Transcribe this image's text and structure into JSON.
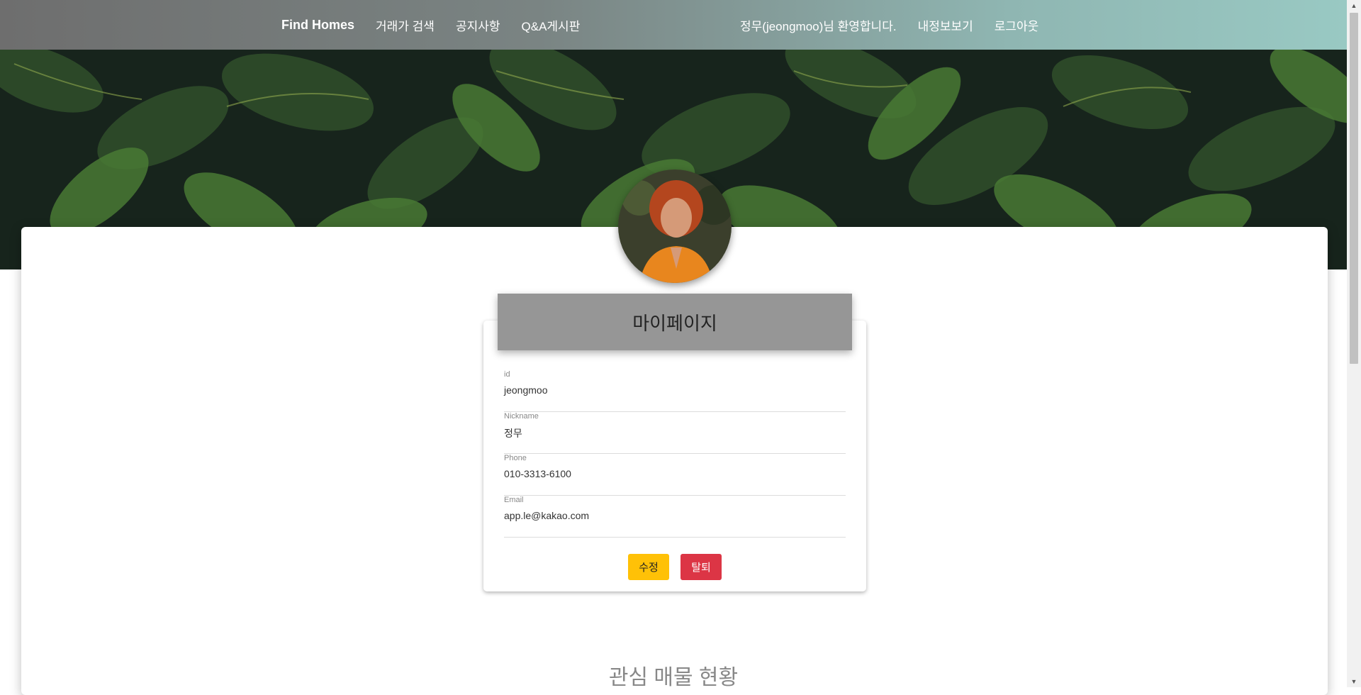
{
  "navbar": {
    "brand": "Find Homes",
    "links": [
      "거래가 검색",
      "공지사항",
      "Q&A게시판"
    ],
    "welcome": "정무(jeongmoo)님 환영합니다.",
    "my_info": "내정보보기",
    "logout": "로그아웃"
  },
  "profile": {
    "title": "마이페이지",
    "fields": [
      {
        "label": "id",
        "value": "jeongmoo"
      },
      {
        "label": "Nickname",
        "value": "정무"
      },
      {
        "label": "Phone",
        "value": "010-3313-6100"
      },
      {
        "label": "Email",
        "value": "app.le@kakao.com"
      }
    ],
    "edit_button": "수정",
    "withdraw_button": "탈퇴"
  },
  "section": {
    "title": "관심 매물 현황"
  },
  "colors": {
    "edit": "#ffc107",
    "withdraw": "#dc3545",
    "header_gray": "#969696"
  }
}
